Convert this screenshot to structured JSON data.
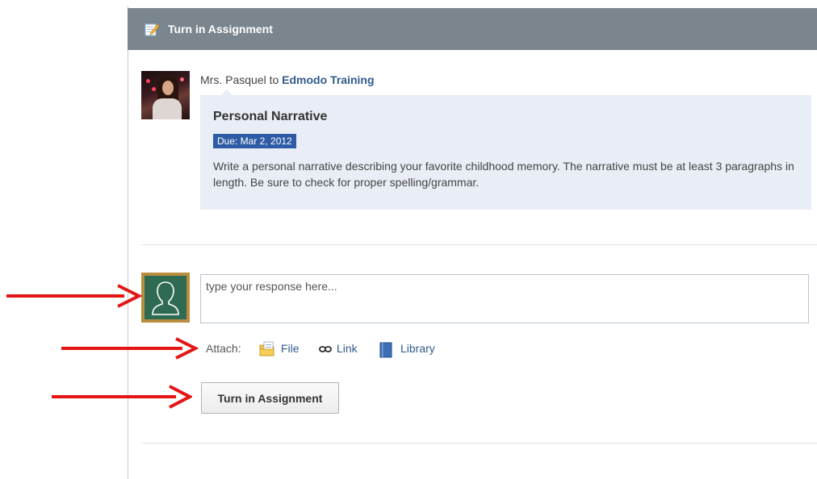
{
  "header": {
    "title": "Turn in Assignment",
    "icon": "pencil-icon"
  },
  "post": {
    "author": "Mrs. Pasquel",
    "connector": "to",
    "group": "Edmodo Training"
  },
  "assignment": {
    "title": "Personal Narrative",
    "due": "Due: Mar 2, 2012",
    "description": "Write a personal narrative describing your favorite childhood memory. The narrative must be at least 3 paragraphs in length. Be sure to check for proper spelling/grammar."
  },
  "response": {
    "placeholder": "type your response here..."
  },
  "attach": {
    "label": "Attach:",
    "file": "File",
    "link": "Link",
    "library": "Library"
  },
  "actions": {
    "submit_label": "Turn in Assignment"
  },
  "colors": {
    "header_bg": "#7b858e",
    "card_bg": "#e9edf5",
    "due_badge": "#2f5ba6",
    "link": "#2f5b8a",
    "annotation_arrow": "#e51515"
  }
}
